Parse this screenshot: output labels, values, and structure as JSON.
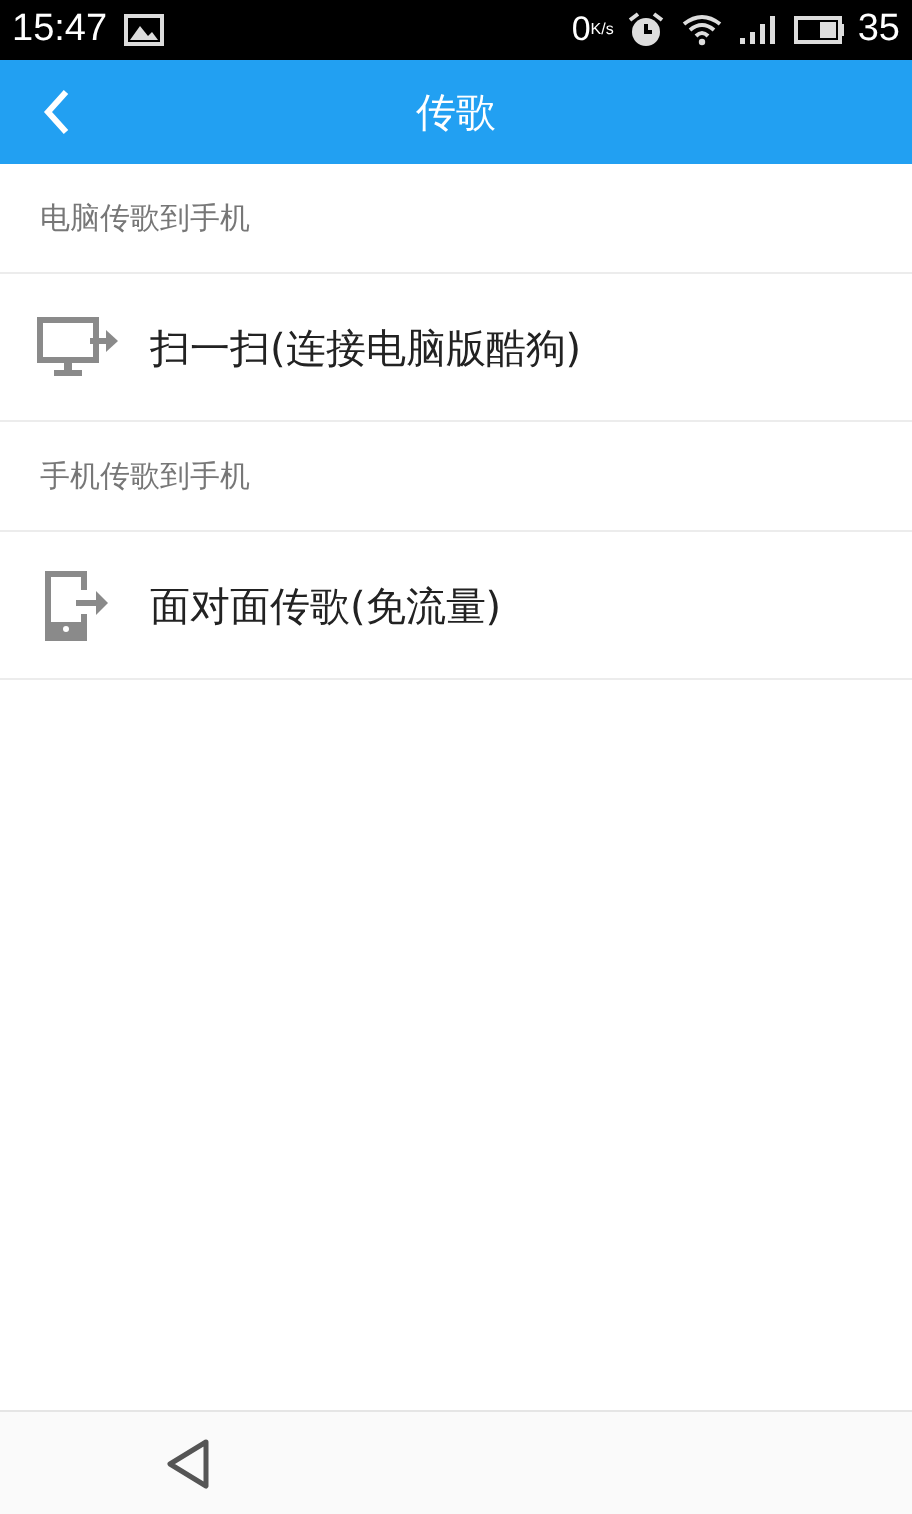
{
  "status_bar": {
    "time": "15:47",
    "speed_value": "0",
    "speed_unit": "K/s",
    "battery": "35"
  },
  "header": {
    "title": "传歌"
  },
  "sections": [
    {
      "title": "电脑传歌到手机",
      "items": [
        {
          "kind": "computer",
          "label": "扫一扫(连接电脑版酷狗)"
        }
      ]
    },
    {
      "title": "手机传歌到手机",
      "items": [
        {
          "kind": "phone",
          "label": "面对面传歌(免流量)"
        }
      ]
    }
  ]
}
